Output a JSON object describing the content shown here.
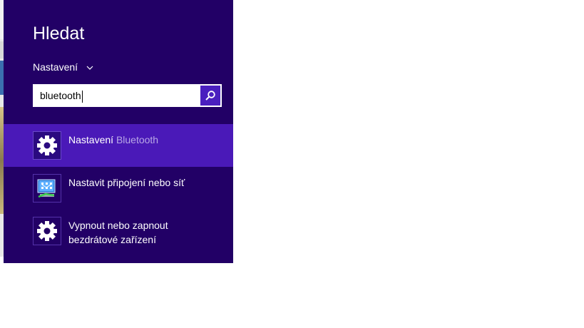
{
  "search_pane": {
    "title": "Hledat",
    "scope_label": "Nastavení",
    "query": "bluetooth",
    "results": [
      {
        "label_part1": "Nastavení",
        "label_part2": "Bluetooth",
        "icon": "gear-icon",
        "selected": true
      },
      {
        "label_part1": "Nastavit připojení nebo síť",
        "icon": "network-setup-icon",
        "selected": false
      },
      {
        "label_line1": "Vypnout nebo zapnout",
        "label_line2": "bezdrátové zařízení",
        "icon": "gear-icon",
        "selected": false
      }
    ]
  },
  "colors": {
    "pane_background": "#220066",
    "selected_row": "#4a19b8",
    "search_button": "#4a1fbf",
    "highlight_text": "#b9a8e6"
  }
}
